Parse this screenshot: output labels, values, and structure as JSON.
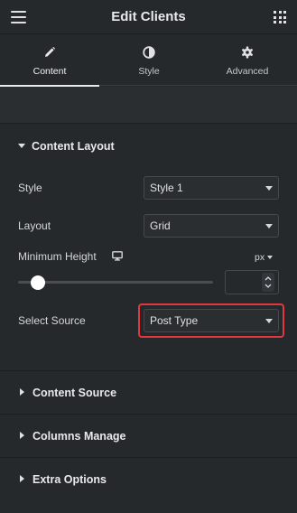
{
  "header": {
    "title": "Edit Clients",
    "menu_icon": "hamburger-menu-icon",
    "apps_icon": "grid-apps-icon"
  },
  "tabs": [
    {
      "label": "Content",
      "icon": "pencil-icon",
      "active": true
    },
    {
      "label": "Style",
      "icon": "half-circle-icon",
      "active": false
    },
    {
      "label": "Advanced",
      "icon": "gear-icon",
      "active": false
    }
  ],
  "content_layout": {
    "title": "Content Layout",
    "style": {
      "label": "Style",
      "value": "Style 1"
    },
    "layout": {
      "label": "Layout",
      "value": "Grid"
    },
    "min_height": {
      "label": "Minimum Height",
      "unit": "px",
      "value": "",
      "slider_fraction": 0.1,
      "device_icon": "desktop-monitor-icon"
    },
    "source": {
      "label": "Select Source",
      "value": "Post Type"
    }
  },
  "sections": [
    {
      "title": "Content Source"
    },
    {
      "title": "Columns Manage"
    },
    {
      "title": "Extra Options"
    }
  ],
  "colors": {
    "panel_bg": "#26292c",
    "highlight": "#e0383e"
  }
}
